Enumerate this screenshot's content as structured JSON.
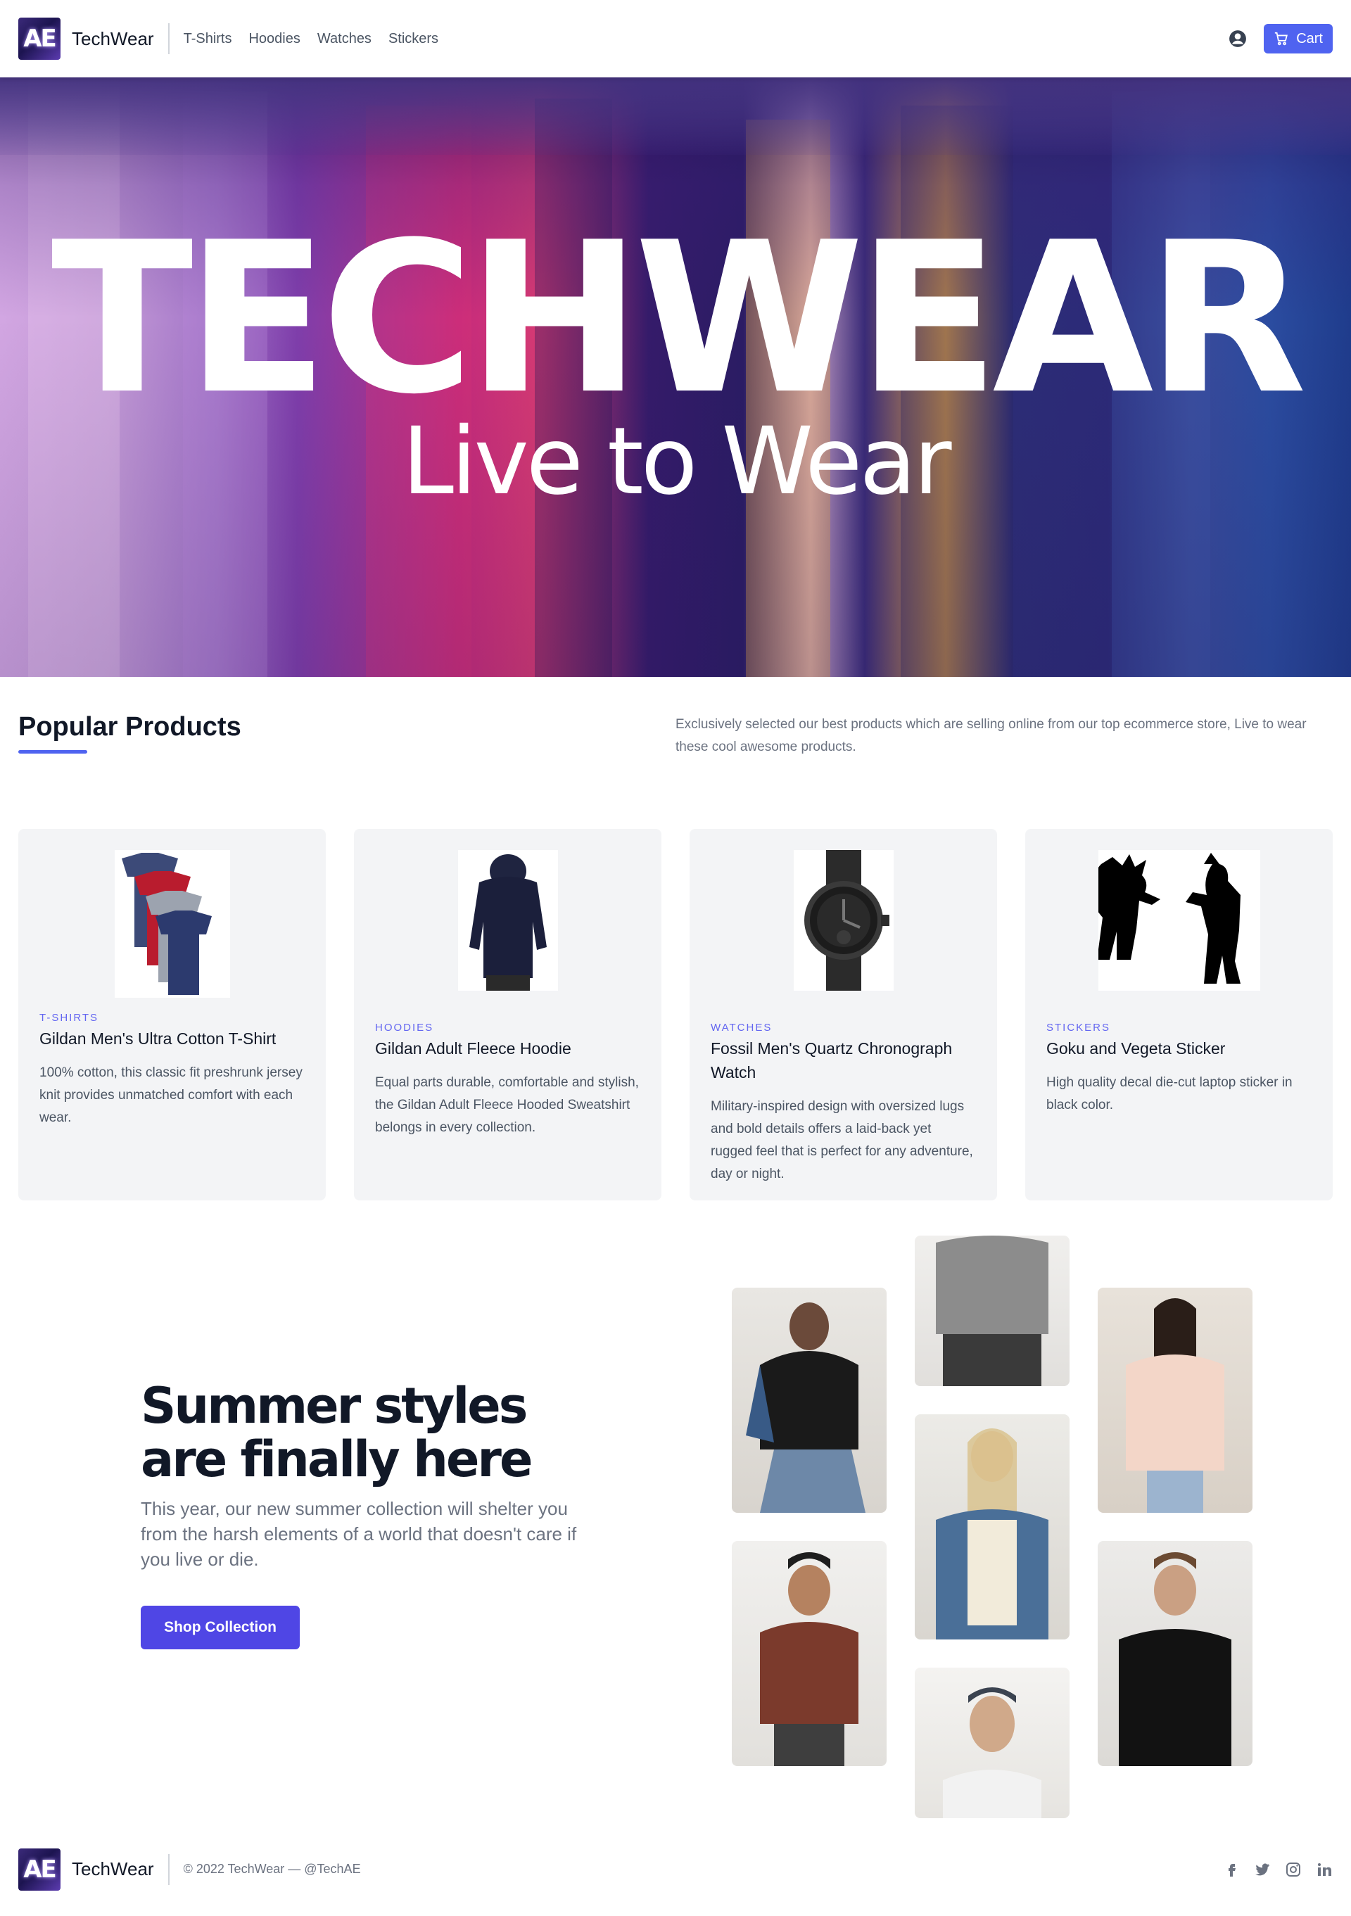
{
  "navbar": {
    "logo_text": "AE",
    "brand": "TechWear",
    "links": [
      "T-Shirts",
      "Hoodies",
      "Watches",
      "Stickers"
    ],
    "cart_label": "Cart",
    "icons": {
      "account": "user-circle-icon",
      "cart": "cart-icon"
    }
  },
  "hero": {
    "title": "TECHWEAR",
    "subtitle": "Live to Wear"
  },
  "popular": {
    "title": "Popular Products",
    "description": "Exclusively selected our best products which are selling online from our top ecommerce store, Live to wear these cool awesome products.",
    "accent_color": "#4f63f0"
  },
  "products": [
    {
      "category": "T-SHIRTS",
      "title": "Gildan Men's Ultra Cotton T-Shirt",
      "description": "100% cotton, this classic fit preshrunk jersey knit provides unmatched comfort with each wear."
    },
    {
      "category": "HOODIES",
      "title": "Gildan Adult Fleece Hoodie",
      "description": "Equal parts durable, comfortable and stylish, the Gildan Adult Fleece Hooded Sweatshirt belongs in every collection."
    },
    {
      "category": "WATCHES",
      "title": "Fossil Men's Quartz Chronograph Watch",
      "description": "Military-inspired design with oversized lugs and bold details offers a laid-back yet rugged feel that is perfect for any adventure, day or night."
    },
    {
      "category": "STICKERS",
      "title": "Goku and Vegeta Sticker",
      "description": "High quality decal die-cut laptop sticker in black color."
    }
  ],
  "summer": {
    "title_line1": "Summer styles",
    "title_line2": "are finally here",
    "text": "This year, our new summer collection will shelter you from the harsh elements of a world that doesn't care if you live or die.",
    "button": "Shop Collection",
    "button_color": "#4f46e5"
  },
  "footer": {
    "logo_text": "AE",
    "brand": "TechWear",
    "copyright": "© 2022 TechWear — @TechAE",
    "social_icons": [
      "facebook-icon",
      "twitter-icon",
      "instagram-icon",
      "linkedin-icon"
    ]
  }
}
